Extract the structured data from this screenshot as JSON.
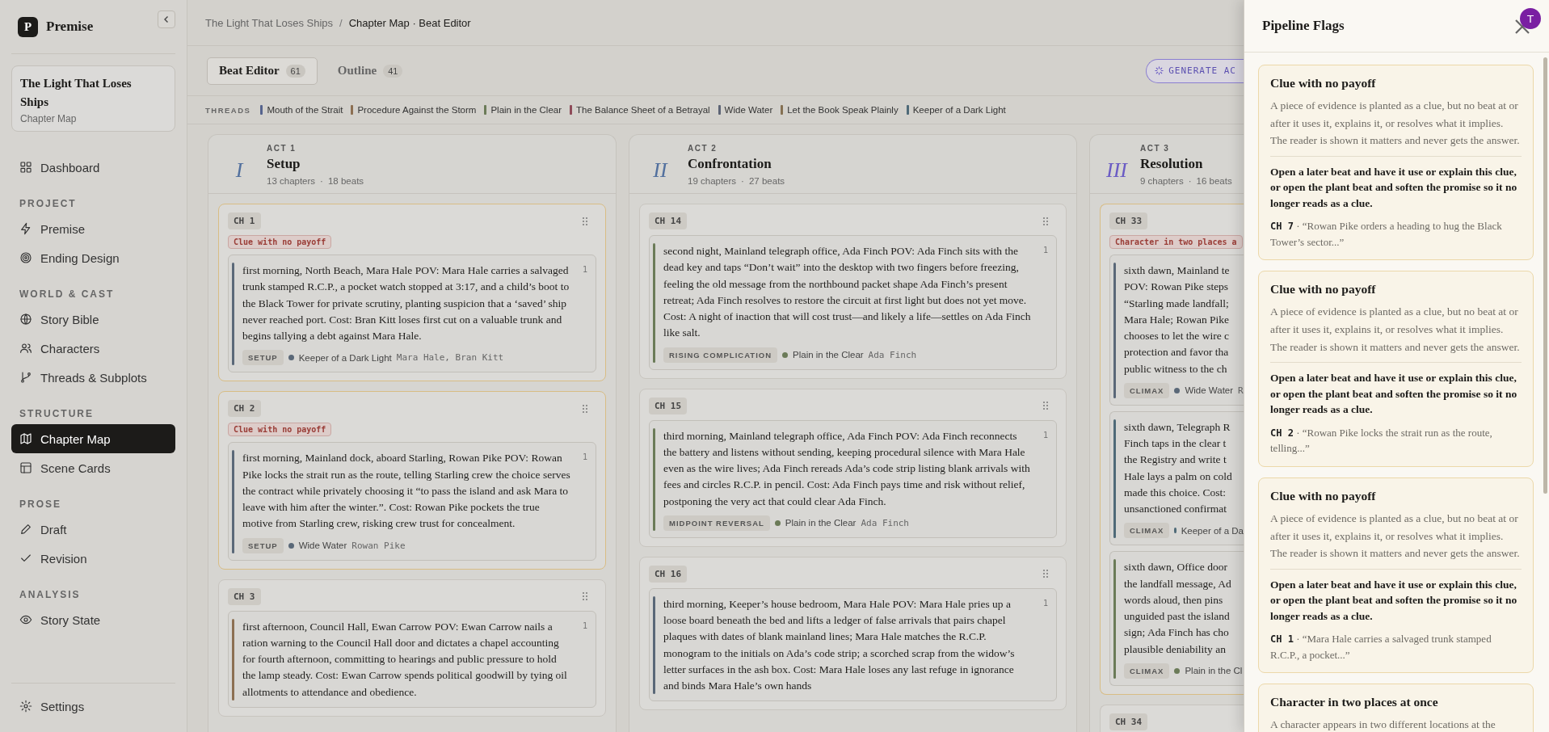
{
  "app": {
    "logo_letter": "P",
    "name": "Premise"
  },
  "project": {
    "title": "The Light That Loses Ships",
    "subtitle": "Chapter Map"
  },
  "nav": [
    {
      "items": [
        {
          "label": "Dashboard",
          "selected": false
        }
      ]
    },
    {
      "heading": "PROJECT",
      "items": [
        {
          "label": "Premise",
          "selected": false
        },
        {
          "label": "Ending Design",
          "selected": false
        }
      ]
    },
    {
      "heading": "WORLD & CAST",
      "items": [
        {
          "label": "Story Bible",
          "selected": false
        },
        {
          "label": "Characters",
          "selected": false
        },
        {
          "label": "Threads & Subplots",
          "selected": false
        }
      ]
    },
    {
      "heading": "STRUCTURE",
      "items": [
        {
          "label": "Chapter Map",
          "selected": true
        },
        {
          "label": "Scene Cards",
          "selected": false
        }
      ]
    },
    {
      "heading": "PROSE",
      "items": [
        {
          "label": "Draft",
          "selected": false
        },
        {
          "label": "Revision",
          "selected": false
        }
      ]
    },
    {
      "heading": "ANALYSIS",
      "items": [
        {
          "label": "Story State",
          "selected": false
        }
      ]
    }
  ],
  "settings": {
    "label": "Settings"
  },
  "breadcrumb": {
    "parent": "The Light That Loses Ships",
    "separator": "/",
    "current": "Chapter Map · Beat Editor"
  },
  "tabs": [
    {
      "label": "Beat Editor",
      "count": "61",
      "selected": true
    },
    {
      "label": "Outline",
      "count": "41",
      "selected": false
    }
  ],
  "generate_button": {
    "label": "GENERATE AC"
  },
  "threads": {
    "label": "THREADS",
    "items": [
      {
        "name": "Mouth of the Strait",
        "color": "#56648e"
      },
      {
        "name": "Procedure Against the Storm",
        "color": "#8c6f52"
      },
      {
        "name": "Plain in the Clear",
        "color": "#6b7b58"
      },
      {
        "name": "The Balance Sheet of a Betrayal",
        "color": "#8e4a58"
      },
      {
        "name": "Wide Water",
        "color": "#5d6475"
      },
      {
        "name": "Let the Book Speak Plainly",
        "color": "#857052"
      },
      {
        "name": "Keeper of a Dark Light",
        "color": "#4f6a78"
      }
    ]
  },
  "acts": [
    {
      "numeral": "I",
      "color": "#52709e",
      "label": "ACT 1",
      "title": "Setup",
      "stats": [
        "13 chapters",
        "18 beats"
      ],
      "separator": "·",
      "chapters": [
        {
          "label": "CH 1",
          "flags": [
            "Clue with no payoff"
          ],
          "beats": [
            {
              "number": "1",
              "color": "#5a6878",
              "text": "first morning, North Beach, Mara Hale POV: Mara Hale carries a salvaged trunk stamped R.C.P., a pocket watch stopped at 3:17, and a child’s boot to the Black Tower for private scrutiny, planting suspicion that a ‘saved’ ship never reached port. Cost: Bran Kitt loses first cut on a valuable trunk and begins tallying a debt against Mara Hale.",
              "tag": "SETUP",
              "thread": "Keeper of a Dark Light",
              "characters": "Mara Hale, Bran Kitt"
            }
          ]
        },
        {
          "label": "CH 2",
          "flags": [
            "Clue with no payoff"
          ],
          "beats": [
            {
              "number": "1",
              "color": "#5a6878",
              "text": "first morning, Mainland dock, aboard Starling, Rowan Pike POV: Rowan Pike locks the strait run as the route, telling Starling crew the choice serves the contract while privately choosing it “to pass the island and ask Mara to leave with him after the winter.”. Cost: Rowan Pike pockets the true motive from Starling crew, risking crew trust for concealment.",
              "tag": "SETUP",
              "thread": "Wide Water",
              "characters": "Rowan Pike"
            }
          ]
        },
        {
          "label": "CH 3",
          "beats": [
            {
              "number": "1",
              "color": "#8c6f52",
              "text": "first afternoon, Council Hall, Ewan Carrow POV: Ewan Carrow nails a ration warning to the Council Hall door and dictates a chapel accounting for fourth afternoon, committing to hearings and public pressure to hold the lamp steady. Cost: Ewan Carrow spends political goodwill by tying oil allotments to attendance and obedience."
            }
          ]
        }
      ]
    },
    {
      "numeral": "II",
      "color": "#52709e",
      "label": "ACT 2",
      "title": "Confrontation",
      "stats": [
        "19 chapters",
        "27 beats"
      ],
      "separator": "·",
      "chapters": [
        {
          "label": "CH 14",
          "beats": [
            {
              "number": "1",
              "color": "#6b7b58",
              "text": "second night, Mainland telegraph office, Ada Finch POV: Ada Finch sits with the dead key and taps “Don’t wait” into the desktop with two fingers before freezing, feeling the old message from the northbound packet shape Ada Finch’s present retreat; Ada Finch resolves to restore the circuit at first light but does not yet move. Cost: A night of inaction that will cost trust—and likely a life—settles on Ada Finch like salt.",
              "tag": "RISING COMPLICATION",
              "thread": "Plain in the Clear",
              "characters": "Ada Finch"
            }
          ]
        },
        {
          "label": "CH 15",
          "beats": [
            {
              "number": "1",
              "color": "#6b7b58",
              "text": "third morning, Mainland telegraph office, Ada Finch POV: Ada Finch reconnects the battery and listens without sending, keeping procedural silence with Mara Hale even as the wire lives; Ada Finch rereads Ada’s code strip listing blank arrivals with fees and circles R.C.P. in pencil. Cost: Ada Finch pays time and risk without relief, postponing the very act that could clear Ada Finch.",
              "tag": "MIDPOINT REVERSAL",
              "thread": "Plain in the Clear",
              "characters": "Ada Finch"
            }
          ]
        },
        {
          "label": "CH 16",
          "beats": [
            {
              "number": "1",
              "color": "#5a6878",
              "text": "third morning, Keeper’s house bedroom, Mara Hale POV: Mara Hale pries up a loose board beneath the bed and lifts a ledger of false arrivals that pairs chapel plaques with dates of blank mainland lines; Mara Hale matches the R.C.P. monogram to the initials on Ada’s code strip; a scorched scrap from the widow’s letter surfaces in the ash box. Cost: Mara Hale loses any last refuge in ignorance and binds Mara Hale’s own hands"
            }
          ]
        }
      ]
    },
    {
      "numeral": "III",
      "color": "#6a5bc4",
      "label": "ACT 3",
      "title": "Resolution",
      "stats": [
        "9 chapters",
        "16 beats"
      ],
      "separator": "·",
      "chapters": [
        {
          "label": "CH 33",
          "flags": [
            "Character in two places a"
          ],
          "beats": [
            {
              "color": "#5a6878",
              "lines": [
                "sixth dawn, Mainland te",
                "POV: Rowan Pike steps",
                "“Starling made landfall;",
                "Mara Hale; Rowan Pike",
                "chooses to let the wire c",
                "protection and favor tha",
                "public witness to the ch"
              ],
              "tag": "CLIMAX",
              "thread": "Wide Water",
              "characters": "R"
            },
            {
              "color": "#4f6a78",
              "lines": [
                "sixth dawn, Telegraph R",
                "Finch taps in the clear t",
                "the Registry and write t",
                "Hale lays a palm on cold",
                "made this choice. Cost:",
                "unsanctioned confirmat"
              ],
              "tag": "CLIMAX",
              "thread": "Keeper of a Da"
            },
            {
              "color": "#6b7b58",
              "lines": [
                "sixth dawn, Office door",
                "the landfall message, Ad",
                "words aloud, then pins",
                "unguided past the island",
                "sign; Ada Finch has cho",
                "plausible deniability an"
              ],
              "tag": "CLIMAX",
              "thread": "Plain in the Cl"
            }
          ]
        },
        {
          "label": "CH 34"
        }
      ]
    }
  ],
  "drawer": {
    "title": "Pipeline Flags",
    "avatar": "T",
    "flags": [
      {
        "title": "Clue with no payoff",
        "description": "A piece of evidence is planted as a clue, but no beat at or after it uses it, explains it, or resolves what it implies. The reader is shown it matters and never gets the answer.",
        "fix": "Open a later beat and have it use or explain this clue, or open the plant beat and soften the promise so it no longer reads as a clue.",
        "chapter": "CH 7",
        "quote": "· “Rowan Pike orders a heading to hug the Black Tower’s sector...”"
      },
      {
        "title": "Clue with no payoff",
        "description": "A piece of evidence is planted as a clue, but no beat at or after it uses it, explains it, or resolves what it implies. The reader is shown it matters and never gets the answer.",
        "fix": "Open a later beat and have it use or explain this clue, or open the plant beat and soften the promise so it no longer reads as a clue.",
        "chapter": "CH 2",
        "quote": "· “Rowan Pike locks the strait run as the route, telling...”"
      },
      {
        "title": "Clue with no payoff",
        "description": "A piece of evidence is planted as a clue, but no beat at or after it uses it, explains it, or resolves what it implies. The reader is shown it matters and never gets the answer.",
        "fix": "Open a later beat and have it use or explain this clue, or open the plant beat and soften the promise so it no longer reads as a clue.",
        "chapter": "CH 1",
        "quote": "· “Mara Hale carries a salvaged trunk stamped R.C.P., a pocket...”"
      },
      {
        "title": "Character in two places at once",
        "description": "A character appears in two different locations at the"
      }
    ]
  }
}
